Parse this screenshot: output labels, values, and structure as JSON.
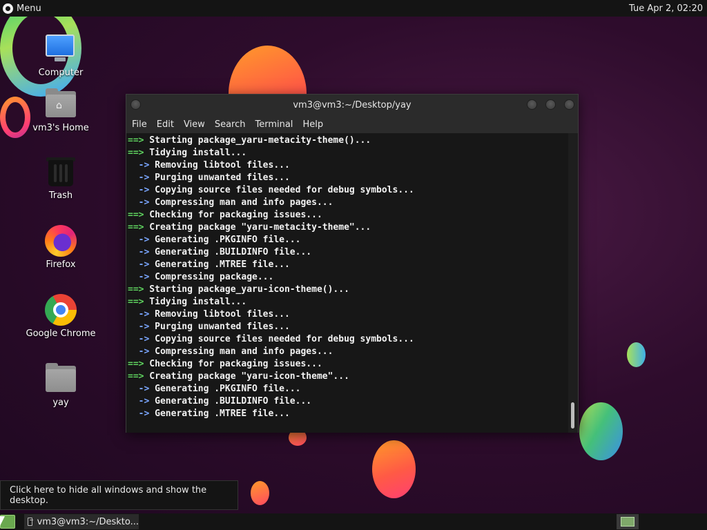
{
  "top_panel": {
    "menu_label": "Menu",
    "clock": "Tue Apr  2, 02:20"
  },
  "desktop_icons": [
    {
      "label": "Computer",
      "icon": "computer-icon"
    },
    {
      "label": "vm3's Home",
      "icon": "home-folder-icon"
    },
    {
      "label": "Trash",
      "icon": "trash-icon"
    },
    {
      "label": "Firefox",
      "icon": "firefox-icon"
    },
    {
      "label": "Google Chrome",
      "icon": "chrome-icon"
    },
    {
      "label": "yay",
      "icon": "folder-icon"
    }
  ],
  "terminal": {
    "title": "vm3@vm3:~/Desktop/yay",
    "menu": [
      "File",
      "Edit",
      "View",
      "Search",
      "Terminal",
      "Help"
    ],
    "lines": [
      {
        "prefix": "==>",
        "text": " Starting package_yaru-metacity-theme()..."
      },
      {
        "prefix": "==>",
        "text": " Tidying install..."
      },
      {
        "prefix": "  ->",
        "text": " Removing libtool files..."
      },
      {
        "prefix": "  ->",
        "text": " Purging unwanted files..."
      },
      {
        "prefix": "  ->",
        "text": " Copying source files needed for debug symbols..."
      },
      {
        "prefix": "  ->",
        "text": " Compressing man and info pages..."
      },
      {
        "prefix": "==>",
        "text": " Checking for packaging issues..."
      },
      {
        "prefix": "==>",
        "text": " Creating package \"yaru-metacity-theme\"..."
      },
      {
        "prefix": "  ->",
        "text": " Generating .PKGINFO file..."
      },
      {
        "prefix": "  ->",
        "text": " Generating .BUILDINFO file..."
      },
      {
        "prefix": "  ->",
        "text": " Generating .MTREE file..."
      },
      {
        "prefix": "  ->",
        "text": " Compressing package..."
      },
      {
        "prefix": "==>",
        "text": " Starting package_yaru-icon-theme()..."
      },
      {
        "prefix": "==>",
        "text": " Tidying install..."
      },
      {
        "prefix": "  ->",
        "text": " Removing libtool files..."
      },
      {
        "prefix": "  ->",
        "text": " Purging unwanted files..."
      },
      {
        "prefix": "  ->",
        "text": " Copying source files needed for debug symbols..."
      },
      {
        "prefix": "  ->",
        "text": " Compressing man and info pages..."
      },
      {
        "prefix": "==>",
        "text": " Checking for packaging issues..."
      },
      {
        "prefix": "==>",
        "text": " Creating package \"yaru-icon-theme\"..."
      },
      {
        "prefix": "  ->",
        "text": " Generating .PKGINFO file..."
      },
      {
        "prefix": "  ->",
        "text": " Generating .BUILDINFO file..."
      },
      {
        "prefix": "  ->",
        "text": " Generating .MTREE file..."
      }
    ]
  },
  "tooltip": "Click here to hide all windows and show the desktop.",
  "taskbar": {
    "task_label": "vm3@vm3:~/Deskto..."
  },
  "colors": {
    "prompt_green": "#5fd35f",
    "arrow_blue": "#7aa6ff",
    "terminal_bg": "#171717",
    "panel_bg": "#141414"
  }
}
